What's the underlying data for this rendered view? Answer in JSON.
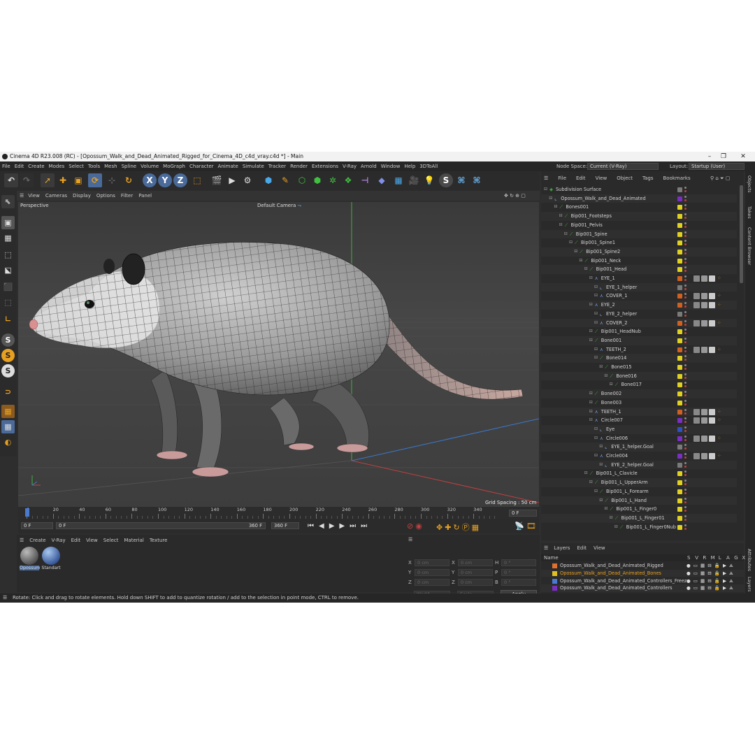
{
  "window": {
    "title": "Cinema 4D R23.008 (RC) - [Opossum_Walk_and_Dead_Animated_Rigged_for_Cinema_4D_c4d_vray.c4d *] - Main",
    "minimize": "–",
    "maximize": "❐",
    "close": "✕"
  },
  "menubar": {
    "items": [
      "File",
      "Edit",
      "Create",
      "Modes",
      "Select",
      "Tools",
      "Mesh",
      "Spline",
      "Volume",
      "MoGraph",
      "Character",
      "Animate",
      "Simulate",
      "Tracker",
      "Render",
      "Extensions",
      "V-Ray",
      "Arnold",
      "Window",
      "Help",
      "3DToAll"
    ],
    "node_space_label": "Node Space:",
    "node_space_value": "Current (V-Ray)",
    "layout_label": "Layout:",
    "layout_value": "Startup (User)"
  },
  "viewport": {
    "menu": [
      "View",
      "Cameras",
      "Display",
      "Options",
      "Filter",
      "Panel"
    ],
    "name": "Perspective",
    "camera": "Default Camera",
    "grid_spacing": "Grid Spacing : 50 cm"
  },
  "timeline": {
    "ticks": [
      "0",
      "20",
      "40",
      "60",
      "80",
      "100",
      "120",
      "140",
      "160",
      "180",
      "200",
      "220",
      "240",
      "260",
      "280",
      "300",
      "320",
      "340"
    ],
    "end_frame": "0 F"
  },
  "playbar": {
    "start": "0 F",
    "current": "0 F",
    "end1": "360 F",
    "end2": "360 F"
  },
  "material_panel": {
    "menu": [
      "Create",
      "V-Ray",
      "Edit",
      "View",
      "Select",
      "Material",
      "Texture"
    ],
    "materials": [
      {
        "name": "Opossum"
      },
      {
        "name": "Standart"
      }
    ]
  },
  "coord_panel": {
    "labels": [
      "X",
      "Y",
      "Z",
      "X",
      "Y",
      "Z",
      "H",
      "P",
      "B"
    ],
    "values": [
      "0 cm",
      "0 cm",
      "0 cm",
      "0 cm",
      "0 cm",
      "0 cm",
      "0 °",
      "0 °",
      "0 °"
    ],
    "mode1": "World",
    "mode2": "Scale",
    "apply": "Apply"
  },
  "statusbar": {
    "text": "Rotate: Click and drag to rotate elements. Hold down SHIFT to add to quantize rotation / add to the selection in point mode, CTRL to remove."
  },
  "object_manager": {
    "menu": [
      "File",
      "Edit",
      "View",
      "Object",
      "Tags",
      "Bookmarks"
    ],
    "rows": [
      {
        "name": "Subdivision Surface",
        "indent": 0,
        "color": "#7a7a7a",
        "icon": "subdiv"
      },
      {
        "name": "Opossum_Walk_and_Dead_Animated",
        "indent": 1,
        "color": "#7a2fc0",
        "icon": "null"
      },
      {
        "name": "Bones001",
        "indent": 2,
        "color": "#e0d020",
        "icon": "bone"
      },
      {
        "name": "Bip001_Footsteps",
        "indent": 3,
        "color": "#e0d020",
        "icon": "bone"
      },
      {
        "name": "Bip001_Pelvis",
        "indent": 3,
        "color": "#e0d020",
        "icon": "bone"
      },
      {
        "name": "Bip001_Spine",
        "indent": 4,
        "color": "#e0d020",
        "icon": "bone"
      },
      {
        "name": "Bip001_Spine1",
        "indent": 5,
        "color": "#e0d020",
        "icon": "bone"
      },
      {
        "name": "Bip001_Spine2",
        "indent": 6,
        "color": "#e0d020",
        "icon": "bone"
      },
      {
        "name": "Bip001_Neck",
        "indent": 7,
        "color": "#e0d020",
        "icon": "bone"
      },
      {
        "name": "Bip001_Head",
        "indent": 8,
        "color": "#e0d020",
        "icon": "bone"
      },
      {
        "name": "EYE_1",
        "indent": 9,
        "color": "#d06020",
        "icon": "poly"
      },
      {
        "name": "EYE_1_helper",
        "indent": 10,
        "color": "#7a7a7a",
        "icon": "null"
      },
      {
        "name": "COVER_1",
        "indent": 10,
        "color": "#d06020",
        "icon": "poly"
      },
      {
        "name": "EYE_2",
        "indent": 9,
        "color": "#d06020",
        "icon": "poly"
      },
      {
        "name": "EYE_2_helper",
        "indent": 10,
        "color": "#7a7a7a",
        "icon": "null"
      },
      {
        "name": "COVER_2",
        "indent": 10,
        "color": "#d06020",
        "icon": "poly"
      },
      {
        "name": "Bip001_HeadNub",
        "indent": 9,
        "color": "#e0d020",
        "icon": "bone"
      },
      {
        "name": "Bone001",
        "indent": 9,
        "color": "#e0d020",
        "icon": "bone"
      },
      {
        "name": "TEETH_2",
        "indent": 10,
        "color": "#d06020",
        "icon": "poly"
      },
      {
        "name": "Bone014",
        "indent": 10,
        "color": "#e0d020",
        "icon": "bone"
      },
      {
        "name": "Bone015",
        "indent": 11,
        "color": "#e0d020",
        "icon": "bone"
      },
      {
        "name": "Bone016",
        "indent": 12,
        "color": "#e0d020",
        "icon": "bone"
      },
      {
        "name": "Bone017",
        "indent": 13,
        "color": "#e0d020",
        "icon": "bone"
      },
      {
        "name": "Bone002",
        "indent": 9,
        "color": "#e0d020",
        "icon": "bone"
      },
      {
        "name": "Bone003",
        "indent": 9,
        "color": "#e0d020",
        "icon": "bone"
      },
      {
        "name": "TEETH_1",
        "indent": 9,
        "color": "#d06020",
        "icon": "poly"
      },
      {
        "name": "Circle007",
        "indent": 9,
        "color": "#7a2fc0",
        "icon": "poly"
      },
      {
        "name": "Eye",
        "indent": 10,
        "color": "#3050c0",
        "icon": "null"
      },
      {
        "name": "Circle006",
        "indent": 10,
        "color": "#7a2fc0",
        "icon": "poly"
      },
      {
        "name": "EYE_1_helper.Goal",
        "indent": 11,
        "color": "#7a7a7a",
        "icon": "null"
      },
      {
        "name": "Circle004",
        "indent": 10,
        "color": "#7a2fc0",
        "icon": "poly"
      },
      {
        "name": "EYE_2_helper.Goal",
        "indent": 11,
        "color": "#7a7a7a",
        "icon": "null"
      },
      {
        "name": "Bip001_L_Clavicle",
        "indent": 8,
        "color": "#e0d020",
        "icon": "bone"
      },
      {
        "name": "Bip001_L_UpperArm",
        "indent": 9,
        "color": "#e0d020",
        "icon": "bone"
      },
      {
        "name": "Bip001_L_Forearm",
        "indent": 10,
        "color": "#e0d020",
        "icon": "bone"
      },
      {
        "name": "Bip001_L_Hand",
        "indent": 11,
        "color": "#e0d020",
        "icon": "bone"
      },
      {
        "name": "Bip001_L_Finger0",
        "indent": 12,
        "color": "#e0d020",
        "icon": "bone"
      },
      {
        "name": "Bip001_L_Finger01",
        "indent": 13,
        "color": "#e0d020",
        "icon": "bone"
      },
      {
        "name": "Bip001_L_Finger0Nub",
        "indent": 14,
        "color": "#e0d020",
        "icon": "bone"
      }
    ]
  },
  "layer_manager": {
    "menu": [
      "Layers",
      "Edit",
      "View"
    ],
    "name_header": "Name",
    "flags": [
      "S",
      "V",
      "R",
      "M",
      "L",
      "A",
      "G",
      "X"
    ],
    "layers": [
      {
        "name": "Opossum_Walk_and_Dead_Animated_Rigged",
        "color": "#e07030",
        "highlight": false
      },
      {
        "name": "Opossum_Walk_and_Dead_Animated_Bones",
        "color": "#e0c020",
        "highlight": true
      },
      {
        "name": "Opossum_Walk_and_Dead_Animated_Controllers_Freeze",
        "color": "#4a7ad0",
        "highlight": false
      },
      {
        "name": "Opossum_Walk_and_Dead_Animated_Controllers",
        "color": "#7a2fc0",
        "highlight": false
      }
    ]
  },
  "side_tabs": [
    "Objects",
    "Takes",
    "Content Browser",
    "Attributes",
    "Layers",
    "Str"
  ]
}
